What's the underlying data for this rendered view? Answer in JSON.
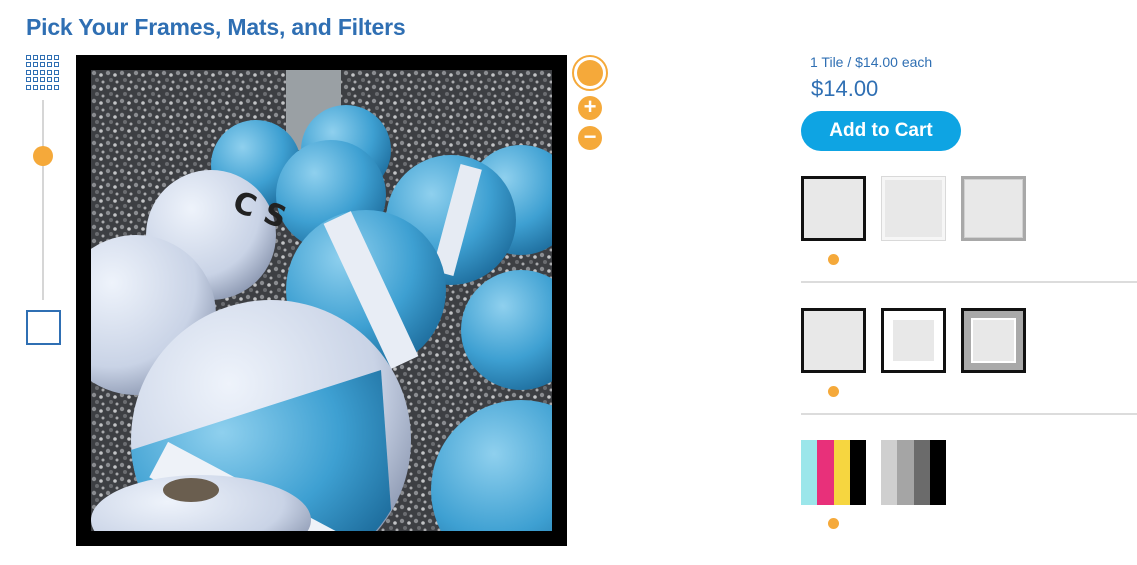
{
  "page": {
    "title": "Pick Your Frames, Mats, and Filters"
  },
  "size_control": {
    "grid_icon": "grid-icon",
    "single_icon": "single-tile-icon",
    "slider_level": 0.72
  },
  "zoom": {
    "zoom_in_icon": "plus-icon",
    "zoom_out_icon": "minus-icon",
    "zoom_in_label": "+",
    "zoom_out_label": "−"
  },
  "pricing": {
    "per_tile": "1 Tile / $14.00 each",
    "total": "$14.00",
    "add_to_cart_label": "Add to Cart"
  },
  "options": {
    "frames": [
      {
        "name": "black-frame",
        "selected": true
      },
      {
        "name": "white-frame",
        "selected": false
      },
      {
        "name": "gray-frame",
        "selected": false
      }
    ],
    "mats": [
      {
        "name": "no-mat",
        "selected": true
      },
      {
        "name": "white-mat",
        "selected": false
      },
      {
        "name": "gray-mat",
        "selected": false
      }
    ],
    "filters": [
      {
        "name": "color-filter",
        "selected": true,
        "colors": [
          "#9be6ea",
          "#e8307a",
          "#f6d640",
          "#000000"
        ]
      },
      {
        "name": "grayscale-filter",
        "selected": false,
        "colors": [
          "#cfcfcf",
          "#a5a5a5",
          "#6b6b6b",
          "#000000"
        ]
      }
    ]
  },
  "colors": {
    "brand_blue": "#2f6fb3",
    "accent_orange": "#f5a93a",
    "cart_button": "#0ea4e3"
  }
}
